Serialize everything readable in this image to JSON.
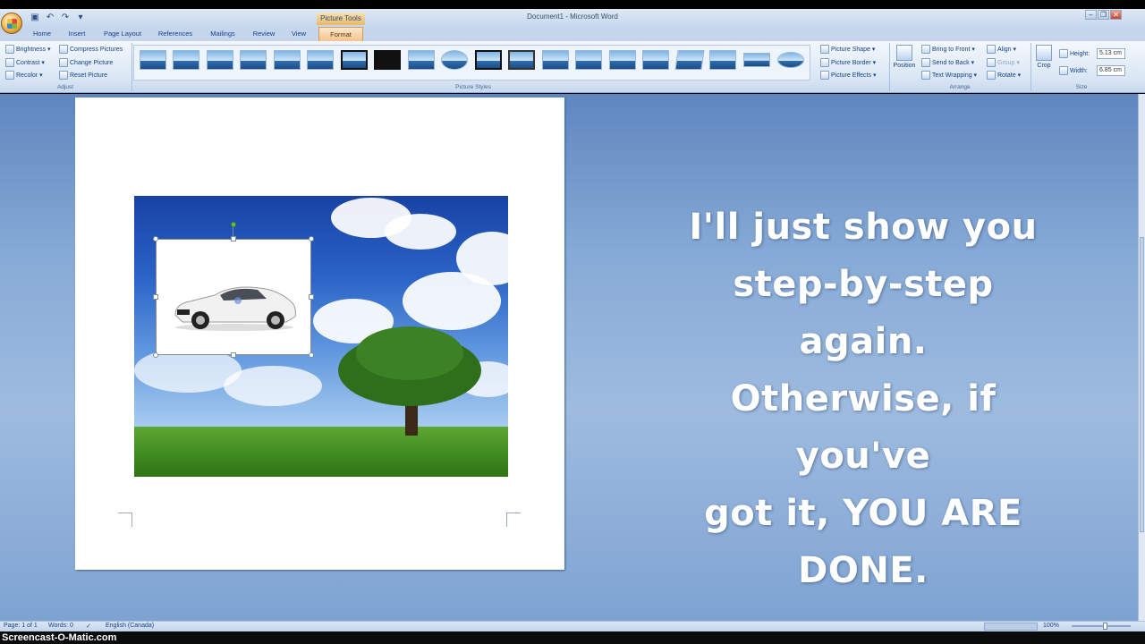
{
  "window": {
    "title": "Document1 - Microsoft Word",
    "context_tab_group": "Picture Tools",
    "controls": {
      "minimize": "–",
      "restore": "❐",
      "close": "✕"
    }
  },
  "qat": {
    "save_icon": "save-icon",
    "undo_icon": "undo-icon",
    "redo_icon": "redo-icon",
    "customize_icon": "customize-icon"
  },
  "tabs": [
    {
      "label": "Home"
    },
    {
      "label": "Insert"
    },
    {
      "label": "Page Layout"
    },
    {
      "label": "References"
    },
    {
      "label": "Mailings"
    },
    {
      "label": "Review"
    },
    {
      "label": "View"
    },
    {
      "label": "Format",
      "active": true
    }
  ],
  "ribbon": {
    "adjust": {
      "brightness": "Brightness ▾",
      "contrast": "Contrast ▾",
      "recolor": "Recolor ▾",
      "compress": "Compress Pictures",
      "change": "Change Picture",
      "reset": "Reset Picture",
      "label": "Adjust"
    },
    "picture_styles": {
      "label": "Picture Styles",
      "shape": "Picture Shape ▾",
      "border": "Picture Border ▾",
      "effects": "Picture Effects ▾"
    },
    "arrange": {
      "position": "Position",
      "bring_front": "Bring to Front ▾",
      "send_back": "Send to Back ▾",
      "text_wrapping": "Text Wrapping ▾",
      "align": "Align ▾",
      "group": "Group ▾",
      "rotate": "Rotate ▾",
      "label": "Arrange"
    },
    "size": {
      "crop": "Crop",
      "height_label": "Height:",
      "height_value": "5.13 cm",
      "width_label": "Width:",
      "width_value": "6.85 cm",
      "label": "Size"
    }
  },
  "overlay_lines": [
    "I'll just show you",
    "step-by-step",
    "again.",
    "Otherwise, if",
    "you've",
    "got it, YOU ARE",
    "DONE."
  ],
  "status": {
    "page": "Page: 1 of 1",
    "words": "Words: 0",
    "language": "English (Canada)",
    "zoom": "100%"
  },
  "watermark": "Screencast-O-Matic.com"
}
